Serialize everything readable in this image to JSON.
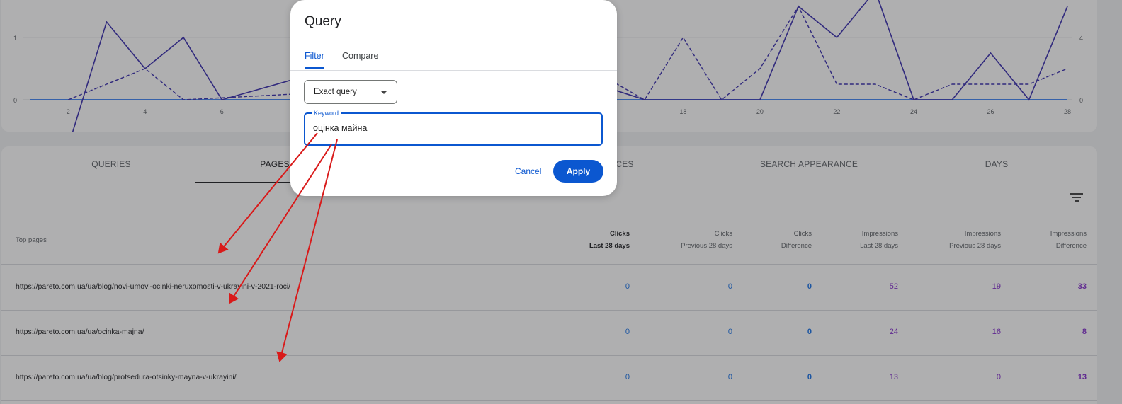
{
  "chart": {
    "left_axis_ticks": [
      "0",
      "1"
    ],
    "right_axis_ticks": [
      "0",
      "4"
    ],
    "x_ticks": [
      "2",
      "4",
      "6",
      "18",
      "20",
      "22",
      "24",
      "26",
      "28"
    ],
    "colors": {
      "clicks": "#3b2fb0",
      "impressions": "#3b2fb0",
      "baseline": "#4285f4",
      "grid": "#e8eaed"
    }
  },
  "tabs": [
    {
      "label": "QUERIES"
    },
    {
      "label": "PAGES"
    },
    {
      "label": "CES"
    },
    {
      "label": "SEARCH APPEARANCE"
    },
    {
      "label": "DAYS"
    }
  ],
  "table": {
    "top_label": "Top pages",
    "columns": [
      {
        "line1": "Clicks",
        "line2": "Last 28 days"
      },
      {
        "line1": "Clicks",
        "line2": "Previous 28 days"
      },
      {
        "line1": "Clicks",
        "line2": "Difference"
      },
      {
        "line1": "Impressions",
        "line2": "Last 28 days"
      },
      {
        "line1": "Impressions",
        "line2": "Previous 28 days"
      },
      {
        "line1": "Impressions",
        "line2": "Difference"
      }
    ],
    "rows": [
      {
        "url": "https://pareto.com.ua/ua/blog/novi-umovi-ocinki-neruxomosti-v-ukrayini-v-2021-roci/",
        "v": [
          "0",
          "0",
          "0",
          "52",
          "19",
          "33"
        ]
      },
      {
        "url": "https://pareto.com.ua/ua/ocinka-majna/",
        "v": [
          "0",
          "0",
          "0",
          "24",
          "16",
          "8"
        ]
      },
      {
        "url": "https://pareto.com.ua/ua/blog/protsedura-otsinky-mayna-v-ukrayini/",
        "v": [
          "0",
          "0",
          "0",
          "13",
          "0",
          "13"
        ]
      }
    ]
  },
  "dialog": {
    "title": "Query",
    "tabs": {
      "filter": "Filter",
      "compare": "Compare"
    },
    "select_value": "Exact query",
    "keyword_label": "Keyword",
    "keyword_value": "оцінка майна",
    "cancel": "Cancel",
    "apply": "Apply",
    "accent": "#0b57d0"
  },
  "annotation": {
    "color": "#d91a1a"
  }
}
